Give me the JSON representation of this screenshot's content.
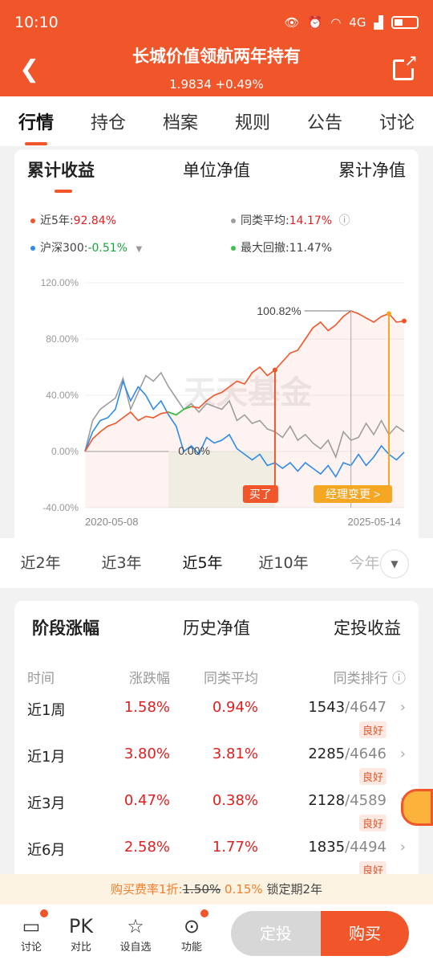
{
  "status": {
    "time": "10:10",
    "network": "4G"
  },
  "header": {
    "title": "长城价值领航两年持有",
    "nav": "1.9834 +0.49%"
  },
  "tabs": [
    "行情",
    "持仓",
    "档案",
    "规则",
    "公告",
    "讨论"
  ],
  "chart_tabs": [
    "累计收益",
    "单位净值",
    "累计净值"
  ],
  "legend": {
    "fund_label": "近5年:",
    "fund_value": "92.84%",
    "peer_label": "同类平均:",
    "peer_value": "14.17%",
    "index_label": "沪深300:",
    "index_value": "-0.51%",
    "dd_label": "最大回撤:",
    "dd_value": "11.47%"
  },
  "colors": {
    "fund": "#f1562a",
    "peer": "#9e9e9e",
    "index": "#2e8bea",
    "drawdown": "#3fbf50"
  },
  "chart_data": {
    "type": "line",
    "x_start": "2020-05-08",
    "x_end": "2025-05-14",
    "ylim": [
      -40,
      120
    ],
    "yticks": [
      "120.00%",
      "80.00%",
      "40.00%",
      "0.00%",
      "-40.00%"
    ],
    "ytick_values": [
      120,
      80,
      40,
      0,
      -40
    ],
    "series": [
      {
        "name": "近5年",
        "values": [
          0,
          9,
          14,
          18,
          20,
          24,
          28,
          22,
          25,
          24,
          27,
          28,
          26,
          30,
          32,
          31,
          36,
          40,
          42,
          46,
          50,
          48,
          56,
          60,
          54,
          58,
          64,
          70,
          72,
          80,
          88,
          92,
          86,
          90,
          96,
          100,
          98,
          95,
          92,
          96,
          98,
          92,
          92.84
        ]
      },
      {
        "name": "同类平均",
        "values": [
          0,
          22,
          30,
          34,
          38,
          52,
          30,
          42,
          54,
          50,
          56,
          46,
          38,
          30,
          34,
          28,
          34,
          32,
          30,
          36,
          22,
          26,
          20,
          22,
          16,
          14,
          10,
          18,
          8,
          12,
          6,
          2,
          8,
          -4,
          14,
          8,
          10,
          20,
          12,
          22,
          12,
          18,
          14.17
        ]
      },
      {
        "name": "沪深300",
        "values": [
          0,
          14,
          22,
          24,
          30,
          50,
          36,
          46,
          40,
          30,
          36,
          26,
          18,
          0,
          4,
          -2,
          10,
          6,
          8,
          12,
          2,
          -2,
          -6,
          -2,
          -10,
          -8,
          -12,
          -8,
          -14,
          -8,
          -12,
          -16,
          -10,
          -18,
          -8,
          -10,
          -2,
          -10,
          -4,
          4,
          -2,
          -6,
          -0.51
        ]
      }
    ],
    "drawdown": {
      "start_index": 11,
      "end_index": 25,
      "label": "0.00%"
    },
    "peak": {
      "index": 35,
      "label": "100.82%"
    },
    "markers": [
      {
        "index": 25,
        "label": "买了"
      },
      {
        "index": 40,
        "label": "经理变更 >"
      }
    ],
    "watermark": "天天基金"
  },
  "periods": [
    "近2年",
    "近3年",
    "近5年",
    "近10年",
    "今年"
  ],
  "stage_tabs": [
    "阶段涨幅",
    "历史净值",
    "定投收益"
  ],
  "table": {
    "headers": [
      "时间",
      "涨跌幅",
      "同类平均",
      "同类排行"
    ],
    "rows": [
      {
        "period": "近1周",
        "change": "1.58%",
        "peer": "0.94%",
        "rank": "1543",
        "total": "/4647",
        "badge": "良好"
      },
      {
        "period": "近1月",
        "change": "3.80%",
        "peer": "3.81%",
        "rank": "2285",
        "total": "/4646",
        "badge": "良好"
      },
      {
        "period": "近3月",
        "change": "0.47%",
        "peer": "0.38%",
        "rank": "2128",
        "total": "/4589",
        "badge": "良好"
      },
      {
        "period": "近6月",
        "change": "2.58%",
        "peer": "1.77%",
        "rank": "1835",
        "total": "/4494",
        "badge": "良好"
      }
    ]
  },
  "promo": {
    "text": "购买费率1折:",
    "old": "1.50%",
    "new": "0.15%",
    "lock": "锁定期2年"
  },
  "bottom": {
    "discuss": "讨论",
    "pk": "PK",
    "compare": "对比",
    "add": "设自选",
    "func": "功能",
    "fixed": "定投",
    "buy": "购买"
  }
}
